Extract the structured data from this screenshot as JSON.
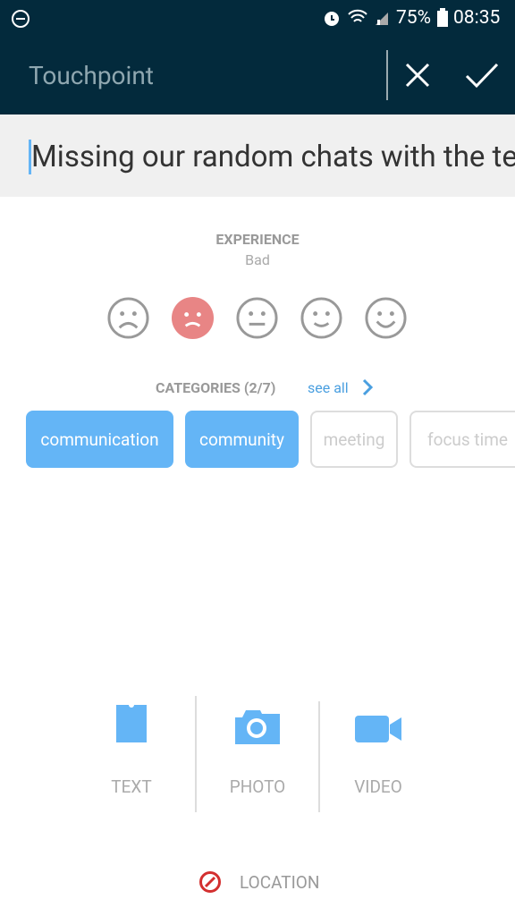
{
  "status": {
    "battery": "75%",
    "time": "08:35"
  },
  "appbar": {
    "title": "Touchpoint"
  },
  "input": {
    "value": "Missing our random chats with the team"
  },
  "experience": {
    "label": "EXPERIENCE",
    "value": "Bad",
    "selected_index": 1,
    "options": [
      "very-bad",
      "bad",
      "neutral",
      "good",
      "very-good"
    ]
  },
  "categories": {
    "label": "CATEGORIES (2/7)",
    "see_all": "see all",
    "chips": [
      {
        "label": "communication",
        "selected": true
      },
      {
        "label": "community",
        "selected": true
      },
      {
        "label": "meeting",
        "selected": false
      },
      {
        "label": "focus time",
        "selected": false
      }
    ]
  },
  "media": {
    "text": "TEXT",
    "photo": "PHOTO",
    "video": "VIDEO"
  },
  "location": {
    "label": "LOCATION"
  },
  "colors": {
    "header": "#032a3c",
    "accent": "#64b5f6",
    "selected_face": "#e88585",
    "location_off": "#d32f2f"
  }
}
